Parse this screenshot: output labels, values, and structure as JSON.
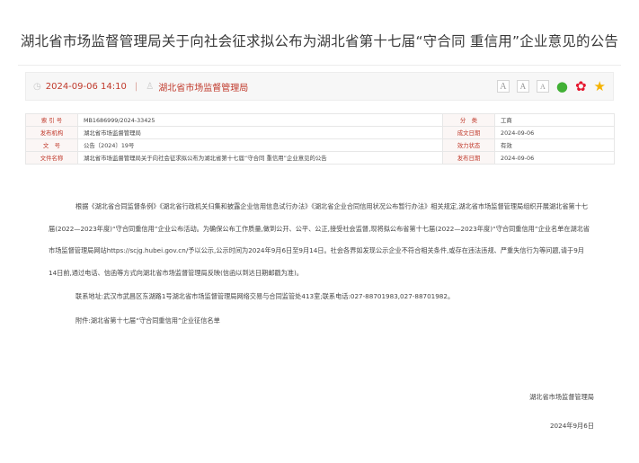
{
  "article": {
    "title": "湖北省市场监督管理局关于向社会征求拟公布为湖北省第十七届“守合同 重信用”企业意见的公告",
    "datetime": "2024-09-06 14:10",
    "separator": "|",
    "source": "湖北省市场监督管理局"
  },
  "toolbar": {
    "font_large": "A",
    "font_medium": "A",
    "font_small": "A"
  },
  "icons": {
    "clock": "clock-icon",
    "person": "person-icon",
    "wechat": "wechat-icon",
    "weibo": "weibo-icon",
    "favorite": "star-icon"
  },
  "colors": {
    "accent": "#c0392b",
    "wechat": "#41b035",
    "weibo": "#e6162d",
    "star": "#f5b301"
  },
  "info_table": [
    {
      "k1": "索 引 号",
      "v1": "MB1686999/2024-33425",
      "k2": "分　类",
      "v2": "工商"
    },
    {
      "k1": "发布机构",
      "v1": "湖北省市场监督管理局",
      "k2": "成文日期",
      "v2": "2024-09-06"
    },
    {
      "k1": "文　号",
      "v1": "公告〔2024〕19号",
      "k2": "效力状态",
      "v2": "有效"
    },
    {
      "k1": "文件名称",
      "v1": "湖北省市场监督管理局关于向社会征求拟公布为湖北省第十七届“守合同 重信用”企业意见的公告",
      "k2": "发布日期",
      "v2": "2024-09-06"
    }
  ],
  "body": {
    "paragraph1": "根据《湖北省合同监督条例》《湖北省行政机关归集和披露企业信用信息试行办法》《湖北省企业合同信用状况公布暂行办法》相关规定,湖北省市场监督管理局组织开展湖北省第十七届(2022—2023年度)“守合同重信用”企业公布活动。为确保公布工作质量,做到公开、公平、公正,接受社会监督,现将拟公布省第十七届(2022—2023年度)“守合同重信用”企业名单在湖北省市场监督管理局网站https://scjg.hubei.gov.cn/予以公示,公示时间为2024年9月6日至9月14日。社会各界如发现公示企业不符合相关条件,或存在违法违规、严重失信行为等问题,请于9月14日前,通过电话、信函等方式向湖北省市场监督管理局反映(信函以到达日期邮戳为准)。",
    "contact": "联系地址:武汉市武昌区东湖路1号湖北省市场监督管理局网络交易与合同监管处413室;联系电话:027-88701983,027-88701982。",
    "attachment": "附件:湖北省第十七届“守合同重信用”企业征信名单"
  },
  "signature": {
    "org": "湖北省市场监督管理局",
    "date": "2024年9月6日"
  }
}
